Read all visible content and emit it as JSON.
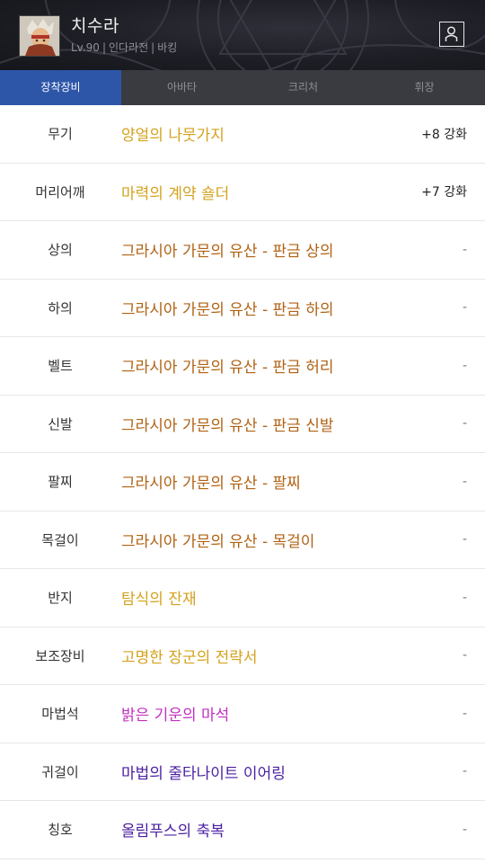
{
  "header": {
    "character_name": "치수라",
    "level": "Lv.90",
    "server": "인다라전",
    "job": "바킹",
    "avatar_icon": "character-portrait",
    "profile_icon": "person-icon"
  },
  "tabs": [
    {
      "label": "장착장비",
      "active": true
    },
    {
      "label": "아바타",
      "active": false
    },
    {
      "label": "크리처",
      "active": false
    },
    {
      "label": "휘장",
      "active": false
    }
  ],
  "colors": {
    "tab_active": "#2d56a8",
    "unique": "#d4a21f",
    "legendary": "#b06214",
    "rare": "#c330c0",
    "epic_purple": "#4a1fa0"
  },
  "equipment": [
    {
      "slot": "무기",
      "item": "양얼의 나뭇가지",
      "enhance": "+8 강화",
      "color": "#d4a21f"
    },
    {
      "slot": "머리어깨",
      "item": "마력의 계약 숄더",
      "enhance": "+7 강화",
      "color": "#d4a21f"
    },
    {
      "slot": "상의",
      "item": "그라시아 가문의 유산 - 판금 상의",
      "enhance": "-",
      "color": "#b06214"
    },
    {
      "slot": "하의",
      "item": "그라시아 가문의 유산 - 판금 하의",
      "enhance": "-",
      "color": "#b06214"
    },
    {
      "slot": "벨트",
      "item": "그라시아 가문의 유산 - 판금 허리",
      "enhance": "-",
      "color": "#b06214"
    },
    {
      "slot": "신발",
      "item": "그라시아 가문의 유산 - 판금 신발",
      "enhance": "-",
      "color": "#b06214"
    },
    {
      "slot": "팔찌",
      "item": "그라시아 가문의 유산 - 팔찌",
      "enhance": "-",
      "color": "#b06214"
    },
    {
      "slot": "목걸이",
      "item": "그라시아 가문의 유산 - 목걸이",
      "enhance": "-",
      "color": "#b06214"
    },
    {
      "slot": "반지",
      "item": "탐식의 잔재",
      "enhance": "-",
      "color": "#d4a21f"
    },
    {
      "slot": "보조장비",
      "item": "고명한 장군의 전략서",
      "enhance": "-",
      "color": "#d4a21f"
    },
    {
      "slot": "마법석",
      "item": "밝은 기운의 마석",
      "enhance": "-",
      "color": "#c330c0"
    },
    {
      "slot": "귀걸이",
      "item": "마법의 줄타나이트 이어링",
      "enhance": "-",
      "color": "#4a1fa0"
    },
    {
      "slot": "칭호",
      "item": "올림푸스의 축복",
      "enhance": "-",
      "color": "#4a1fa0"
    }
  ]
}
